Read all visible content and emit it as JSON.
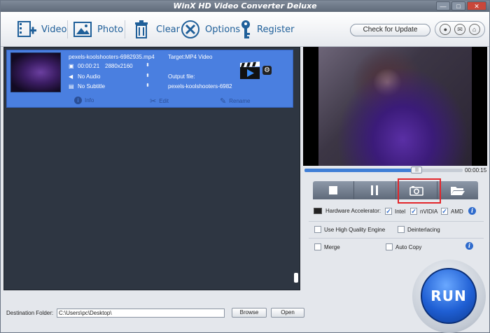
{
  "window": {
    "title": "WinX HD Video Converter Deluxe",
    "min": "—",
    "max": "□",
    "close": "✕"
  },
  "toolbar": {
    "video": "Video",
    "photo": "Photo",
    "clear": "Clear",
    "options": "Options",
    "register": "Register",
    "check_update": "Check for Update"
  },
  "file": {
    "name": "pexels-koolshooters-6982935.mp4",
    "duration": "00:00:21",
    "resolution": "2880x2160",
    "audio": "No Audio",
    "subtitle": "No Subtitle",
    "target": "Target:MP4 Video",
    "output_label": "Output file:",
    "output_name": "pexels-koolshooters-6982",
    "actions": {
      "info": "Info",
      "edit": "Edit",
      "rename": "Rename"
    }
  },
  "destination": {
    "label": "Destination Folder:",
    "path": "C:\\Users\\pc\\Desktop\\",
    "browse": "Browse",
    "open": "Open"
  },
  "player": {
    "time": "00:00:15",
    "progress": 0.71
  },
  "options": {
    "hw_label": "Hardware Accelerator:",
    "intel": "Intel",
    "nvidia": "nVIDIA",
    "amd": "AMD",
    "hq_engine": "Use High Quality Engine",
    "deinterlacing": "Deinterlacing",
    "merge": "Merge",
    "auto_copy": "Auto Copy"
  },
  "run": {
    "label": "RUN"
  },
  "colors": {
    "accent": "#4a7fe0",
    "highlight": "#e3262b",
    "link": "#1f5f99"
  }
}
